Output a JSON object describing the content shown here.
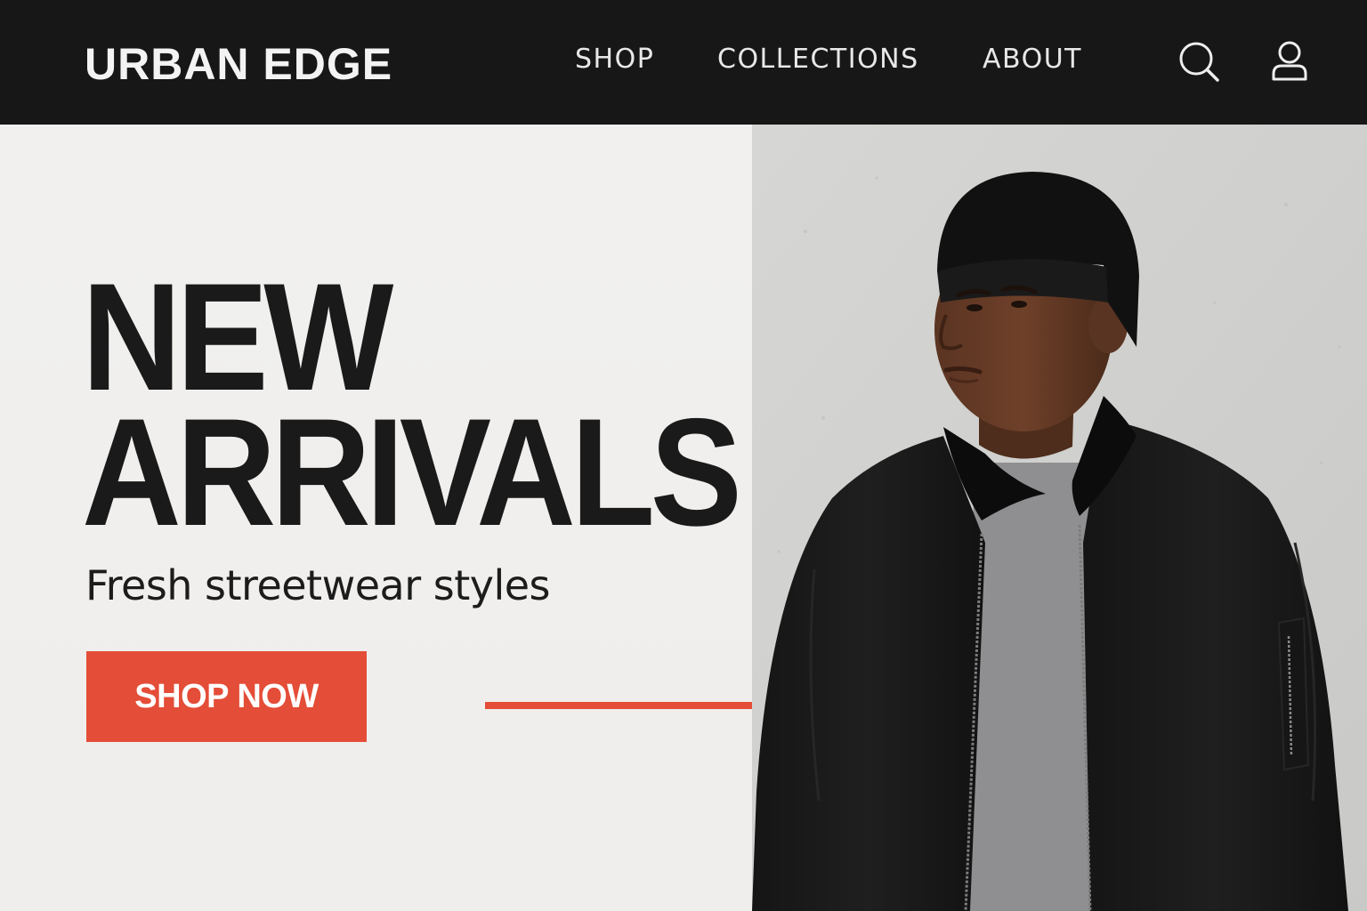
{
  "header": {
    "logo": "URBAN EDGE",
    "nav": [
      "SHOP",
      "COLLECTIONS",
      "ABOUT"
    ],
    "icons": [
      "search-icon",
      "user-icon"
    ]
  },
  "hero": {
    "headline_line1": "NEW",
    "headline_line2": "ARRIVALS",
    "subtitle": "Fresh streetwear styles",
    "cta_label": "SHOP NOW",
    "photo_subject": "model-in-black-beanie-and-bomber-jacket"
  },
  "colors": {
    "header_bg": "#171717",
    "hero_bg": "#f0efed",
    "accent": "#e44d37",
    "headline": "#1a1a1a"
  }
}
